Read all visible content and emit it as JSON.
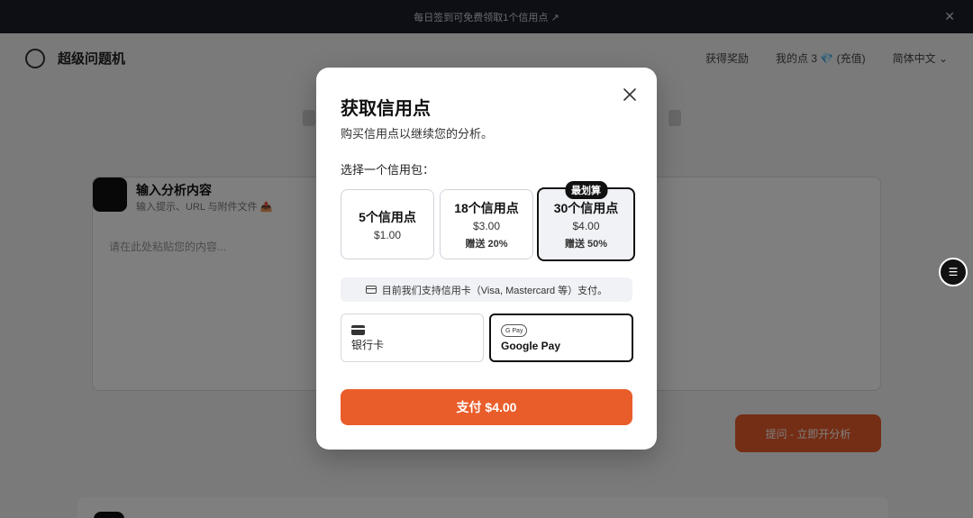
{
  "background": {
    "topbar_text": "每日签到可免费领取1个信用点 ↗",
    "logo_text": "超级问题机",
    "header_links": [
      "获得奖励",
      "我的点 3 💎 (充值)",
      "简体中文 ⌄"
    ],
    "card_title": "输入分析内容",
    "card_subtitle": "输入提示、URL 与附件文件 📤",
    "card_placeholder": "请在此处粘贴您的内容...",
    "analyze_button": "提问 - 立即开分析"
  },
  "modal": {
    "title": "获取信用点",
    "subtitle": "购买信用点以继续您的分析。",
    "choose_label": "选择一个信用包：",
    "packages": [
      {
        "name": "5个信用点",
        "price": "$1.00",
        "bonus": "",
        "badge": ""
      },
      {
        "name": "18个信用点",
        "price": "$3.00",
        "bonus": "赠送 20%",
        "badge": ""
      },
      {
        "name": "30个信用点",
        "price": "$4.00",
        "bonus": "赠送 50%",
        "badge": "最划算"
      }
    ],
    "selected_package": 2,
    "note": "目前我们支持信用卡（Visa, Mastercard 等）支付。",
    "payment_methods": [
      {
        "label": "银行卡",
        "icon": "credit-card-icon"
      },
      {
        "label": "Google Pay",
        "icon": "google-pay-icon",
        "icon_text": "G Pay"
      }
    ],
    "selected_payment": 1,
    "pay_button": "支付 $4.00"
  }
}
